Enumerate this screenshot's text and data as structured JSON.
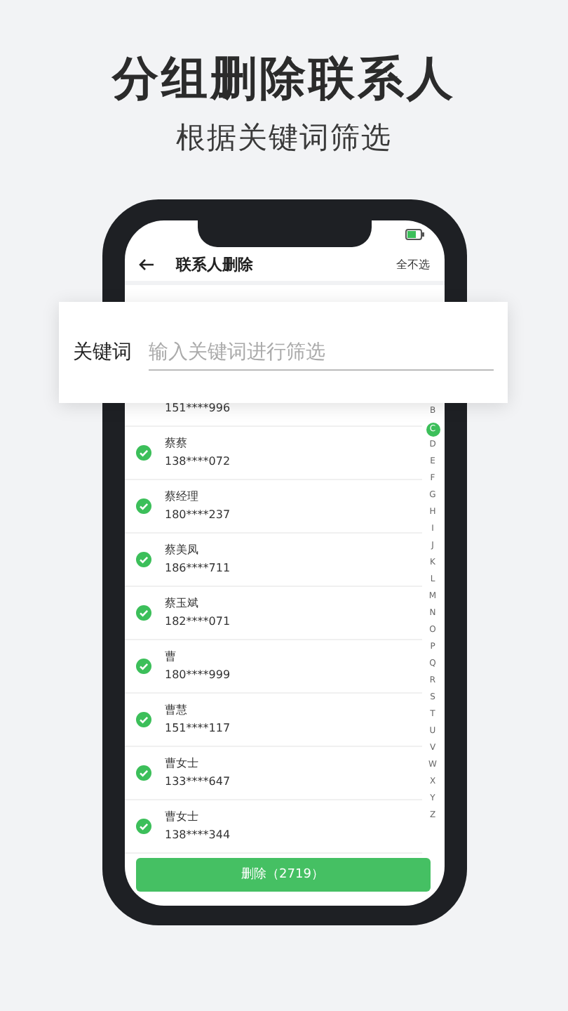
{
  "title": "分组删除联系人",
  "subtitle": "根据关键词筛选",
  "screen": {
    "header": {
      "title": "联系人删除",
      "action": "全不选"
    },
    "partial_row": {
      "phone": "151****996"
    },
    "contacts": [
      {
        "name": "蔡蔡",
        "phone": "138****072",
        "checked": true
      },
      {
        "name": "蔡经理",
        "phone": "180****237",
        "checked": true
      },
      {
        "name": "蔡美凤",
        "phone": "186****711",
        "checked": true
      },
      {
        "name": "蔡玉斌",
        "phone": "182****071",
        "checked": true
      },
      {
        "name": "曹",
        "phone": "180****999",
        "checked": true
      },
      {
        "name": "曹慧",
        "phone": "151****117",
        "checked": true
      },
      {
        "name": "曹女士",
        "phone": "133****647",
        "checked": true
      },
      {
        "name": "曹女士",
        "phone": "138****344",
        "checked": true
      }
    ],
    "index": [
      {
        "letter": "B",
        "selected": false
      },
      {
        "letter": "C",
        "selected": true
      },
      {
        "letter": "D",
        "selected": false
      },
      {
        "letter": "E",
        "selected": false
      },
      {
        "letter": "F",
        "selected": false
      },
      {
        "letter": "G",
        "selected": false
      },
      {
        "letter": "H",
        "selected": false
      },
      {
        "letter": "I",
        "selected": false
      },
      {
        "letter": "J",
        "selected": false
      },
      {
        "letter": "K",
        "selected": false
      },
      {
        "letter": "L",
        "selected": false
      },
      {
        "letter": "M",
        "selected": false
      },
      {
        "letter": "N",
        "selected": false
      },
      {
        "letter": "O",
        "selected": false
      },
      {
        "letter": "P",
        "selected": false
      },
      {
        "letter": "Q",
        "selected": false
      },
      {
        "letter": "R",
        "selected": false
      },
      {
        "letter": "S",
        "selected": false
      },
      {
        "letter": "T",
        "selected": false
      },
      {
        "letter": "U",
        "selected": false
      },
      {
        "letter": "V",
        "selected": false
      },
      {
        "letter": "W",
        "selected": false
      },
      {
        "letter": "X",
        "selected": false
      },
      {
        "letter": "Y",
        "selected": false
      },
      {
        "letter": "Z",
        "selected": false
      }
    ],
    "delete_button": "删除（2719）"
  },
  "filter": {
    "label": "关键词",
    "placeholder": "输入关键词进行筛选"
  }
}
